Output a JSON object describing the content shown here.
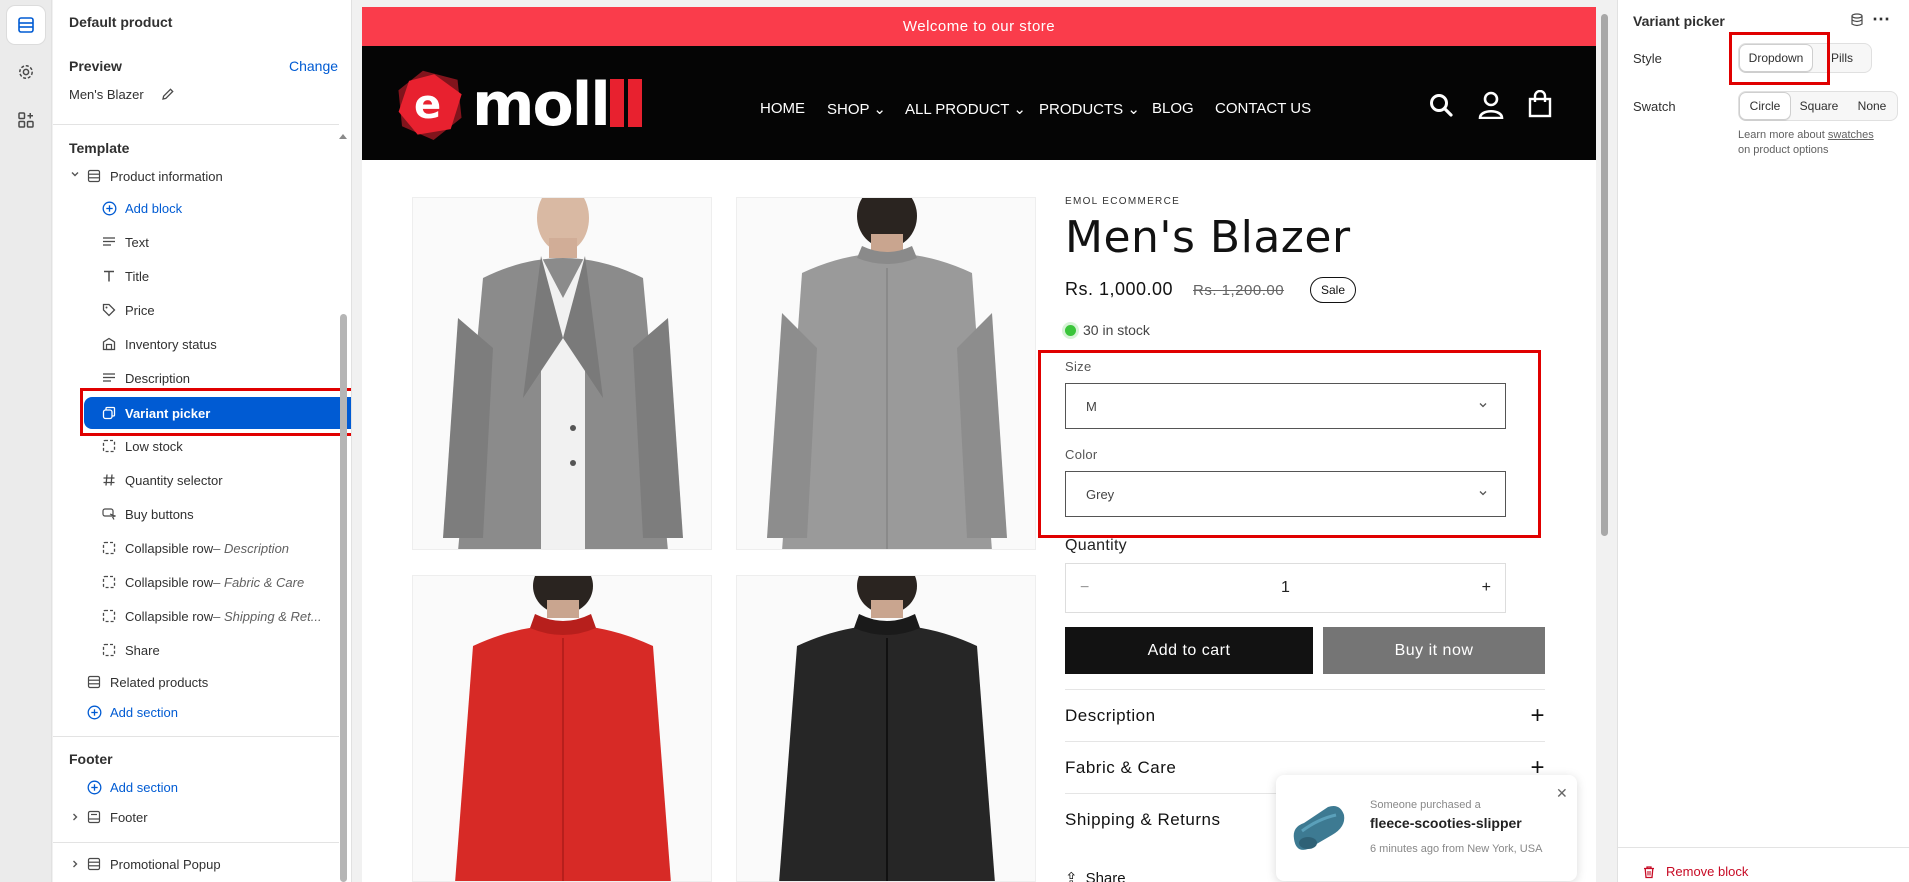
{
  "left_panel": {
    "page_title": "Default product",
    "preview_label": "Preview",
    "change_link": "Change",
    "preview_product": "Men's Blazer",
    "template_heading": "Template",
    "section": "Product information",
    "add_block": "Add block",
    "blocks": [
      {
        "label": "Text",
        "suffix": ""
      },
      {
        "label": "Title",
        "suffix": ""
      },
      {
        "label": "Price",
        "suffix": ""
      },
      {
        "label": "Inventory status",
        "suffix": ""
      },
      {
        "label": "Description",
        "suffix": ""
      },
      {
        "label": "Variant picker",
        "suffix": ""
      },
      {
        "label": "Low stock",
        "suffix": ""
      },
      {
        "label": "Quantity selector",
        "suffix": ""
      },
      {
        "label": "Buy buttons",
        "suffix": ""
      },
      {
        "label": "Collapsible row",
        "suffix": " – Description"
      },
      {
        "label": "Collapsible row",
        "suffix": " – Fabric & Care"
      },
      {
        "label": "Collapsible row",
        "suffix": " – Shipping & Ret..."
      },
      {
        "label": "Share",
        "suffix": ""
      }
    ],
    "related_products": "Related products",
    "add_section": "Add section",
    "footer_heading": "Footer",
    "footer_add_section": "Add section",
    "footer_item": "Footer",
    "promo_popup": "Promotional Popup"
  },
  "store": {
    "announcement": "Welcome to our store",
    "logo_text": "moll",
    "logo_letter": "e",
    "nav": [
      "HOME",
      "SHOP",
      "ALL PRODUCT",
      "PRODUCTS",
      "BLOG",
      "CONTACT US"
    ],
    "vendor": "EMOL ECOMMERCE",
    "product_title": "Men's Blazer",
    "price": "Rs. 1,000.00",
    "compare_price": "Rs. 1,200.00",
    "badge": "Sale",
    "stock": "30 in stock",
    "size_label": "Size",
    "size_value": "M",
    "color_label": "Color",
    "color_value": "Grey",
    "quantity_label": "Quantity",
    "quantity_value": "1",
    "minus": "−",
    "plus": "+",
    "add_to_cart": "Add to cart",
    "buy_now": "Buy it now",
    "accordions": [
      "Description",
      "Fabric & Care",
      "Shipping & Returns"
    ],
    "share": "Share",
    "toast": {
      "line1": "Someone purchased a",
      "product": "fleece-scooties-slipper",
      "line3": "6 minutes ago from New York, USA"
    }
  },
  "right_panel": {
    "title": "Variant picker",
    "style_label": "Style",
    "style_options": [
      "Dropdown",
      "Pills"
    ],
    "style_selected": "Dropdown",
    "swatch_label": "Swatch",
    "swatch_options": [
      "Circle",
      "Square",
      "None"
    ],
    "swatch_selected": "Circle",
    "help_prefix": "Learn more about ",
    "help_link": "swatches",
    "help_suffix": "on product options",
    "remove_block": "Remove block"
  },
  "colors": {
    "accent": "#005bd3",
    "announcement": "#fa3c4b",
    "highlight": "#e00000",
    "brand_red": "#e8212f"
  }
}
